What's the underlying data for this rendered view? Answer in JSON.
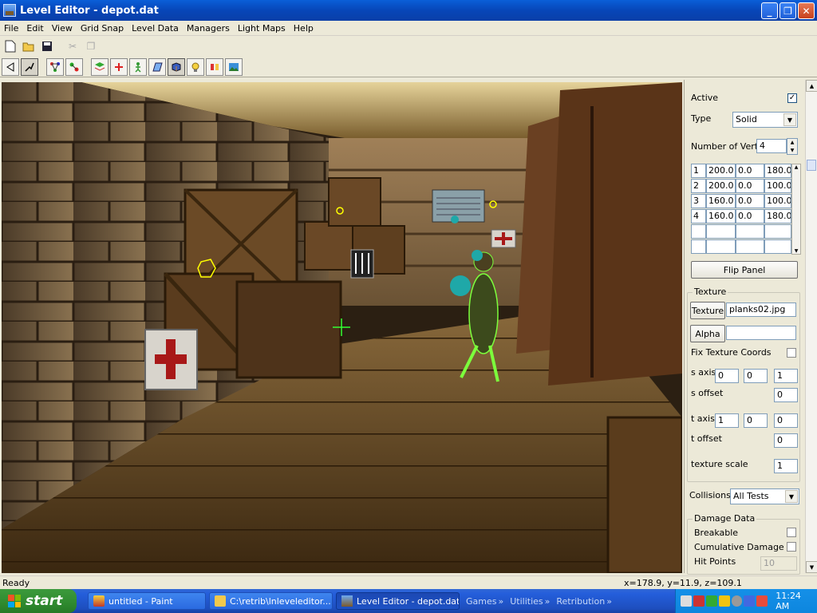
{
  "window": {
    "title": "Level Editor - depot.dat"
  },
  "menu": [
    "File",
    "Edit",
    "View",
    "Grid Snap",
    "Level Data",
    "Managers",
    "Light Maps",
    "Help"
  ],
  "panel": {
    "active_label": "Active",
    "active_checked": true,
    "type_label": "Type",
    "type_value": "Solid",
    "num_verts_label": "Number of Verts",
    "num_verts_value": "4",
    "verts": [
      [
        "1",
        "200.0",
        "0.0",
        "180.0"
      ],
      [
        "2",
        "200.0",
        "0.0",
        "100.0"
      ],
      [
        "3",
        "160.0",
        "0.0",
        "100.0"
      ],
      [
        "4",
        "160.0",
        "0.0",
        "180.0"
      ]
    ],
    "flip_panel_label": "Flip Panel",
    "texture_group_label": "Texture",
    "texture_button_label": "Texture",
    "texture_value": "planks02.jpg",
    "alpha_button_label": "Alpha",
    "alpha_value": "",
    "fix_texture_coords_label": "Fix Texture Coords",
    "s_axis_label": "s axis",
    "s_axis": [
      "0",
      "0",
      "1"
    ],
    "s_offset_label": "s offset",
    "s_offset": "0",
    "t_axis_label": "t axis",
    "t_axis": [
      "1",
      "0",
      "0"
    ],
    "t_offset_label": "t offset",
    "t_offset": "0",
    "texture_scale_label": "texture scale",
    "texture_scale": "1",
    "collisions_label": "Collisions",
    "collisions_value": "All Tests",
    "damage_group_label": "Damage Data",
    "breakable_label": "Breakable",
    "cumulative_damage_label": "Cumulative Damage",
    "hit_points_label": "Hit Points",
    "hit_points_value": "10"
  },
  "status": {
    "left": "Ready",
    "coords": "x=178.9, y=11.9, z=109.1"
  },
  "taskbar": {
    "start_label": "start",
    "tasks": [
      "untitled - Paint",
      "C:\\retrib\\lnleveleditor...",
      "Level Editor - depot.dat"
    ],
    "quick_launch": [
      "Games",
      "Utilities",
      "Retribution"
    ],
    "clock": "11:24 AM"
  },
  "colors": {
    "titlebar": "#0a5fd8",
    "taskbar": "#245edb",
    "start": "#3c9a3c",
    "tray": "#1590e8"
  }
}
